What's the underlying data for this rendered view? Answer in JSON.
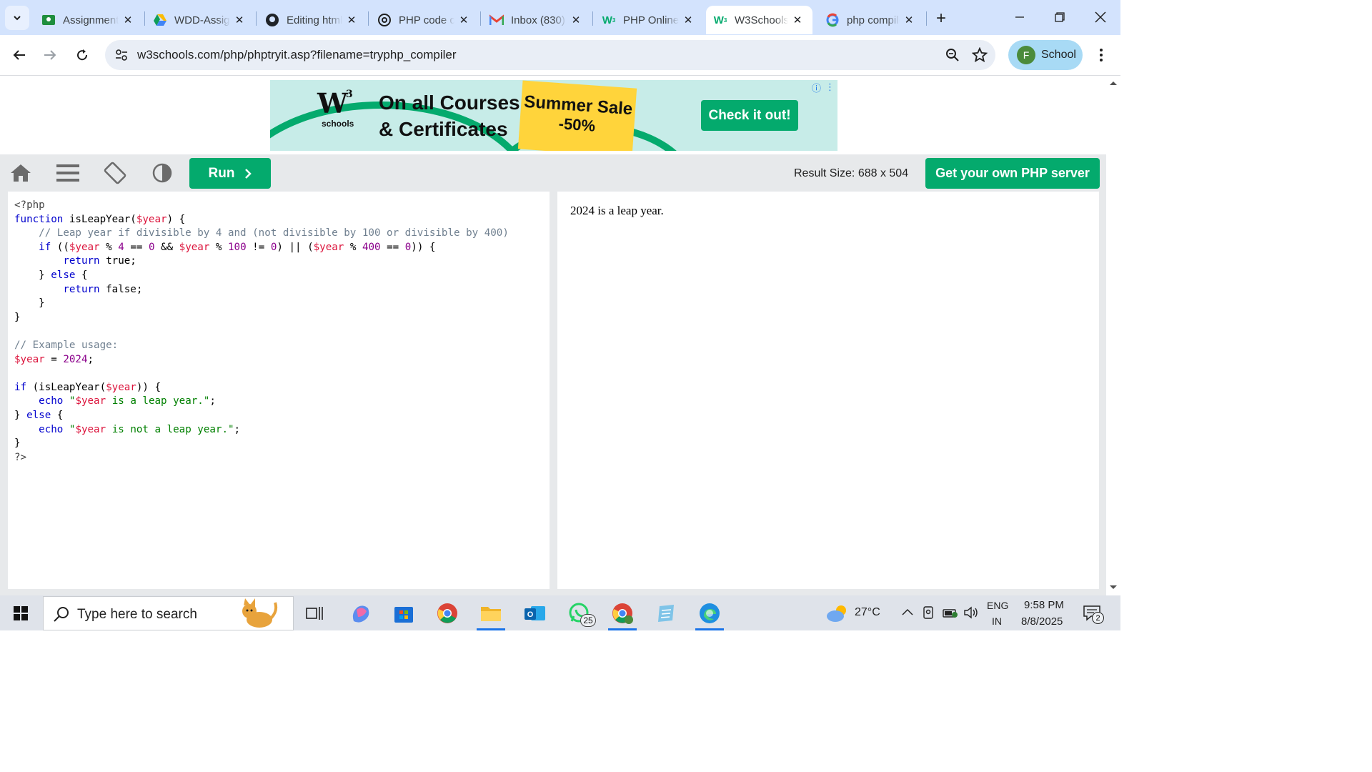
{
  "browser": {
    "tabs": [
      {
        "title": "Assignment",
        "icon": "classroom-icon",
        "active": false
      },
      {
        "title": "WDD-Assignment",
        "icon": "drive-icon",
        "active": false
      },
      {
        "title": "Editing html",
        "icon": "github-icon",
        "active": false
      },
      {
        "title": "PHP code compiler",
        "icon": "chatgpt-icon",
        "active": false
      },
      {
        "title": "Inbox (830)",
        "icon": "gmail-icon",
        "active": false
      },
      {
        "title": "PHP Online Compiler",
        "icon": "w3schools-icon",
        "active": false
      },
      {
        "title": "W3Schools",
        "icon": "w3schools-icon",
        "active": true
      },
      {
        "title": "php compiler",
        "icon": "google-icon",
        "active": false
      }
    ],
    "new_tab_label": "+",
    "url": "w3schools.com/php/phptryit.asp?filename=tryphp_compiler",
    "profile": {
      "initial": "F",
      "label": "School",
      "color": "#4b8b3b"
    }
  },
  "ad": {
    "brand_sup": "3",
    "brand_sub": "schools",
    "line1": "On all Courses",
    "line2": "& Certificates",
    "sale_title": "Summer Sale",
    "sale_discount": "-50%",
    "cta": "Check it out!"
  },
  "w3": {
    "run_label": "Run",
    "result_size_label": "Result Size: 688 x 504",
    "get_server_label": "Get your own PHP server",
    "accent": "#04aa6d"
  },
  "code_lines": [
    [
      [
        "tag",
        "<?php"
      ]
    ],
    [
      [
        "kw",
        "function"
      ],
      [
        "plain",
        " isLeapYear("
      ],
      [
        "var",
        "$year"
      ],
      [
        "plain",
        ") {"
      ]
    ],
    [
      [
        "plain",
        "    "
      ],
      [
        "cm",
        "// Leap year if divisible by 4 and (not divisible by 100 or divisible by 400)"
      ]
    ],
    [
      [
        "plain",
        "    "
      ],
      [
        "kw",
        "if"
      ],
      [
        "plain",
        " (("
      ],
      [
        "var",
        "$year"
      ],
      [
        "plain",
        " % "
      ],
      [
        "num",
        "4"
      ],
      [
        "plain",
        " == "
      ],
      [
        "num",
        "0"
      ],
      [
        "plain",
        " && "
      ],
      [
        "var",
        "$year"
      ],
      [
        "plain",
        " % "
      ],
      [
        "num",
        "100"
      ],
      [
        "plain",
        " != "
      ],
      [
        "num",
        "0"
      ],
      [
        "plain",
        ") || ("
      ],
      [
        "var",
        "$year"
      ],
      [
        "plain",
        " % "
      ],
      [
        "num",
        "400"
      ],
      [
        "plain",
        " == "
      ],
      [
        "num",
        "0"
      ],
      [
        "plain",
        ")) {"
      ]
    ],
    [
      [
        "plain",
        "        "
      ],
      [
        "kw",
        "return"
      ],
      [
        "plain",
        " true;"
      ]
    ],
    [
      [
        "plain",
        "    } "
      ],
      [
        "kw",
        "else"
      ],
      [
        "plain",
        " {"
      ]
    ],
    [
      [
        "plain",
        "        "
      ],
      [
        "kw",
        "return"
      ],
      [
        "plain",
        " false;"
      ]
    ],
    [
      [
        "plain",
        "    }"
      ]
    ],
    [
      [
        "plain",
        "}"
      ]
    ],
    [
      [
        "plain",
        ""
      ]
    ],
    [
      [
        "cm",
        "// Example usage:"
      ]
    ],
    [
      [
        "var",
        "$year"
      ],
      [
        "plain",
        " = "
      ],
      [
        "num",
        "2024"
      ],
      [
        "plain",
        ";"
      ]
    ],
    [
      [
        "plain",
        ""
      ]
    ],
    [
      [
        "kw",
        "if"
      ],
      [
        "plain",
        " (isLeapYear("
      ],
      [
        "var",
        "$year"
      ],
      [
        "plain",
        ")) {"
      ]
    ],
    [
      [
        "plain",
        "    "
      ],
      [
        "kw",
        "echo"
      ],
      [
        "plain",
        " "
      ],
      [
        "str",
        "\""
      ],
      [
        "var",
        "$year"
      ],
      [
        "str",
        " is a leap year.\""
      ],
      [
        "plain",
        ";"
      ]
    ],
    [
      [
        "plain",
        "} "
      ],
      [
        "kw",
        "else"
      ],
      [
        "plain",
        " {"
      ]
    ],
    [
      [
        "plain",
        "    "
      ],
      [
        "kw",
        "echo"
      ],
      [
        "plain",
        " "
      ],
      [
        "str",
        "\""
      ],
      [
        "var",
        "$year"
      ],
      [
        "str",
        " is not a leap year.\""
      ],
      [
        "plain",
        ";"
      ]
    ],
    [
      [
        "plain",
        "}"
      ]
    ],
    [
      [
        "tag",
        "?>"
      ]
    ]
  ],
  "output_text": "2024 is a leap year.",
  "taskbar": {
    "search_placeholder": "Type here to search",
    "whatsapp_badge": "25",
    "weather": "27°C",
    "lang1": "ENG",
    "lang2": "IN",
    "time": "9:58 PM",
    "date": "8/8/2025",
    "notifications": "2"
  }
}
